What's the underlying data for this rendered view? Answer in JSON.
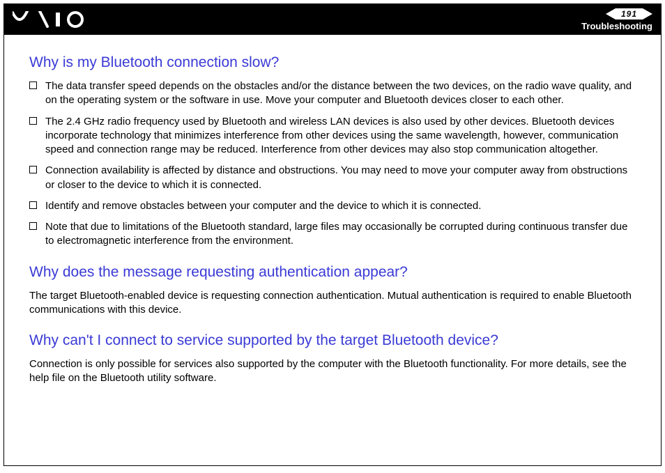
{
  "header": {
    "page_number": "191",
    "section": "Troubleshooting"
  },
  "sections": [
    {
      "heading": "Why is my Bluetooth connection slow?",
      "bullets": [
        "The data transfer speed depends on the obstacles and/or the distance between the two devices, on the radio wave quality, and on the operating system or the software in use. Move your computer and Bluetooth devices closer to each other.",
        "The 2.4 GHz radio frequency used by Bluetooth and wireless LAN devices is also used by other devices. Bluetooth devices incorporate technology that minimizes interference from other devices using the same wavelength, however, communication speed and connection range may be reduced. Interference from other devices may also stop communication altogether.",
        "Connection availability is affected by distance and obstructions. You may need to move your computer away from obstructions or closer to the device to which it is connected.",
        "Identify and remove obstacles between your computer and the device to which it is connected.",
        "Note that due to limitations of the Bluetooth standard, large files may occasionally be corrupted during continuous transfer due to electromagnetic interference from the environment."
      ]
    },
    {
      "heading": "Why does the message requesting authentication appear?",
      "paragraph": "The target Bluetooth-enabled device is requesting connection authentication. Mutual authentication is required to enable Bluetooth communications with this device."
    },
    {
      "heading": "Why can't I connect to service supported by the target Bluetooth device?",
      "paragraph": "Connection is only possible for services also supported by the computer with the Bluetooth functionality. For more details, see the help file on the Bluetooth utility software."
    }
  ]
}
